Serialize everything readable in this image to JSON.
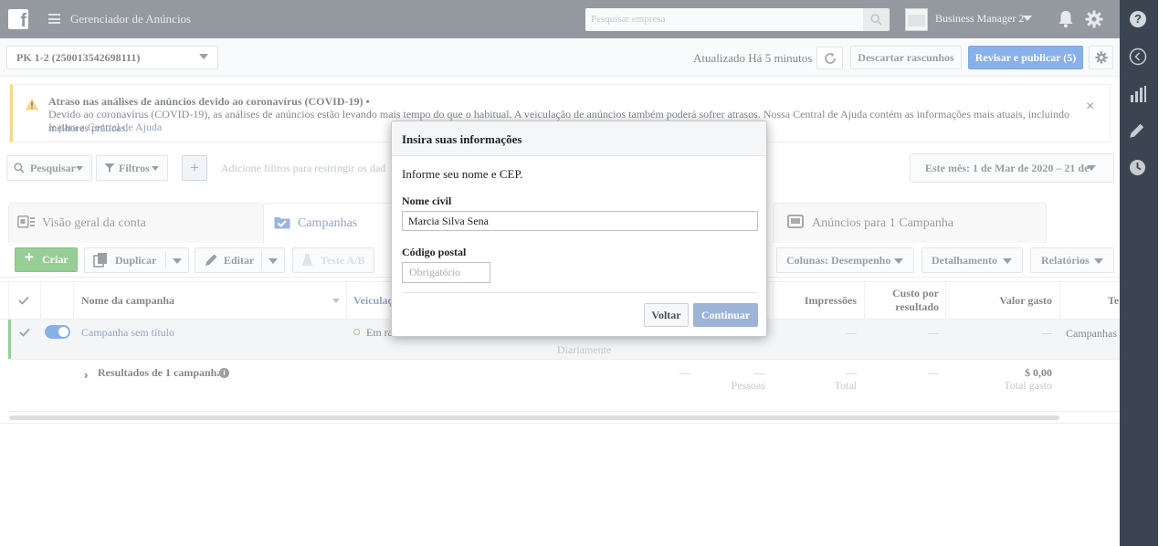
{
  "topbar": {
    "app_title": "Gerenciador de Anúncios",
    "search_placeholder": "Pesquisar empresa",
    "business_manager": "Business Manager 2",
    "help_glyph": "?"
  },
  "toolbar": {
    "account": "PK 1-2 (250013542698111)",
    "updated": "Atualizado Há 5 minutos",
    "discard": "Descartar rascunhos",
    "publish": "Revisar e publicar (5)"
  },
  "alert": {
    "title": "Atraso nas análises de anúncios devido ao coronavírus (COVID-19) •",
    "body": "Devido ao coronavírus (COVID-19), as análises de anúncios estão levando mais tempo do que o habitual. A veiculação de anúncios também poderá sofrer atrasos. Nossa Central de Ajuda contém as informações mais atuais, incluindo melhores práticas.",
    "link": "Ir para a Central de Ajuda",
    "close": "×"
  },
  "filters": {
    "search": "Pesquisar",
    "filters": "Filtros",
    "add": "+",
    "hint": "Adicione filtros para restringir os dad",
    "date_range": "Este mês: 1 de Mar de 2020 – 21 de"
  },
  "tabs": {
    "overview": "Visão geral da conta",
    "campaigns": "Campanhas",
    "ads": "Anúncios para 1 Campanha"
  },
  "actions": {
    "create": "Criar",
    "duplicate": "Duplicar",
    "edit": "Editar",
    "ab_test": "Teste A/B",
    "columns": "Colunas: Desempenho",
    "breakdown": "Detalhamento",
    "reports": "Relatórios"
  },
  "table": {
    "headers": {
      "name": "Nome da campanha",
      "delivery": "Veiculaç",
      "impressions": "Impressões",
      "cost_per_result": "Custo por resultado",
      "amount_spent": "Valor gasto",
      "end": "Te"
    },
    "campaign_row": {
      "name": "Campanha sem título",
      "delivery": "Em ra",
      "budget_freq": "Diariamente",
      "dash": "—",
      "end": "Campanhas c"
    },
    "summary_row": {
      "label": "Resultados de 1 campanha",
      "dash": "—",
      "people": "Pessoas",
      "total": "Total",
      "spent": "$ 0,00",
      "spent_label": "Total gasto"
    }
  },
  "dialog": {
    "title": "Insira suas informações",
    "intro": "Informe seu nome e CEP.",
    "name_label": "Nome civil",
    "name_value": "Marcia Silva Sena",
    "zip_label": "Código postal",
    "zip_placeholder": "Obrigatório",
    "back": "Voltar",
    "continue": "Continuar"
  }
}
